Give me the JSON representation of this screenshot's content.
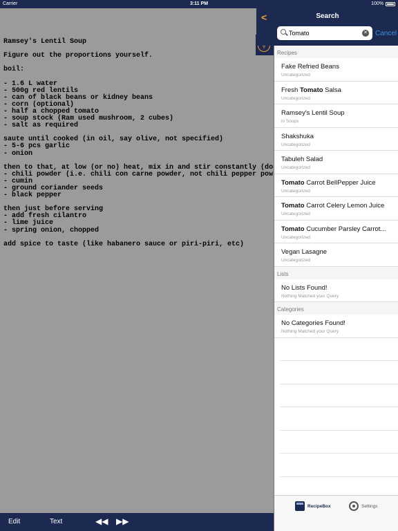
{
  "status_bar": {
    "carrier": "Carrier",
    "time": "3:11 PM",
    "battery": "100%"
  },
  "document": {
    "lines": [
      "Ramsey's Lentil Soup",
      "",
      "Figure out the proportions yourself.",
      "",
      "boil:",
      "",
      "- 1.6 L water",
      "- 500g red lentils",
      "- can of black beans or kidney beans",
      "- corn (optional)",
      "- half a chopped tomato",
      "- soup stock (Ram used mushroom, 2 cubes)",
      "- salt as required",
      "",
      "saute until cooked (in oil, say olive, not specified)",
      "- 5-6 pcs garlic",
      "- onion",
      "",
      "then to that, at low (or no) heat, mix in and stir constantly (do",
      "- chili powder (i.e. chili con carne powder, not chili pepper pow",
      "- cumin",
      "- ground coriander seeds",
      "- black pepper",
      "",
      "then just before serving",
      "- add fresh cilantro",
      "- lime juice",
      "- spring onion, chopped",
      "",
      "add spice to taste (like habanero sauce or piri-piri, etc)"
    ]
  },
  "toolbar": {
    "edit": "Edit",
    "text": "Text",
    "rewind": "◀◀",
    "forward": "▶▶"
  },
  "search": {
    "title": "Search",
    "back": "<",
    "query": "Tomato",
    "cancel": "Cancel",
    "sections": {
      "recipes": "Recipes",
      "lists": "Lists",
      "categories": "Categories"
    },
    "recipes": [
      {
        "pre": "",
        "bold": "",
        "post": "Fake Refried Beans",
        "sub": "Uncategorized"
      },
      {
        "pre": "Fresh ",
        "bold": "Tomato",
        "post": " Salsa",
        "sub": "Uncategorized"
      },
      {
        "pre": "",
        "bold": "",
        "post": "Ramsey's Lentil Soup",
        "sub": "in Soups"
      },
      {
        "pre": "",
        "bold": "",
        "post": "Shakshuka",
        "sub": "Uncategorized"
      },
      {
        "pre": "",
        "bold": "",
        "post": "Tabuleh Salad",
        "sub": "Uncategorized"
      },
      {
        "pre": "",
        "bold": "Tomato",
        "post": " Carrot BellPepper Juice",
        "sub": "Uncategorized"
      },
      {
        "pre": "",
        "bold": "Tomato",
        "post": " Carrot Celery Lemon Juice",
        "sub": "Uncategorized"
      },
      {
        "pre": "",
        "bold": "Tomato",
        "post": " Cucumber Parsley Carrot...",
        "sub": "Uncategorized"
      },
      {
        "pre": "",
        "bold": "",
        "post": "Vegan Lasagne",
        "sub": "Uncategorized"
      }
    ],
    "lists_empty": {
      "title": "No Lists Found!",
      "sub": "Nothing Matched your Query"
    },
    "categories_empty": {
      "title": "No Categories Found!",
      "sub": "Nothing Matched your Query"
    }
  },
  "tabbar": {
    "recipebox": "RecipeBox",
    "settings": "Settings"
  },
  "colors": {
    "navy": "#1c2a52",
    "accent": "#f0a020",
    "link": "#3a8ddc"
  }
}
